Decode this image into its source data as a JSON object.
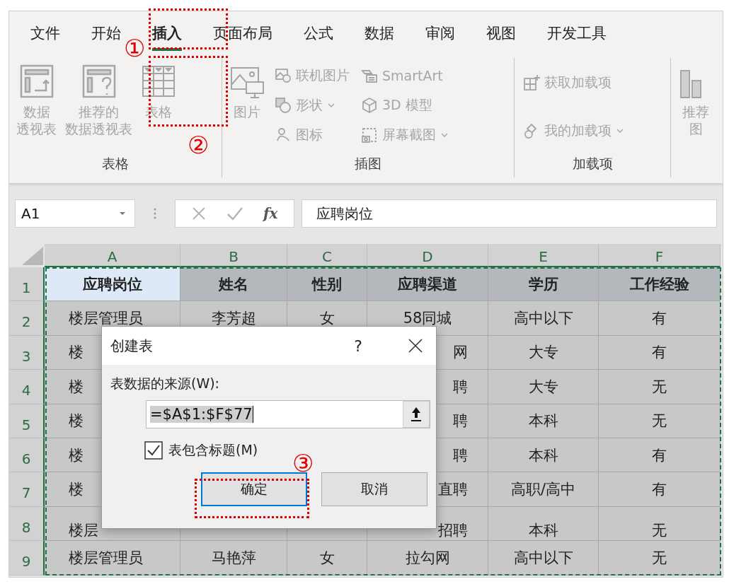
{
  "tabs": [
    {
      "label": "文件",
      "selected": false
    },
    {
      "label": "开始",
      "selected": false
    },
    {
      "label": "插入",
      "selected": true
    },
    {
      "label": "页面布局",
      "selected": false
    },
    {
      "label": "公式",
      "selected": false
    },
    {
      "label": "数据",
      "selected": false
    },
    {
      "label": "审阅",
      "selected": false
    },
    {
      "label": "视图",
      "selected": false
    },
    {
      "label": "开发工具",
      "selected": false
    }
  ],
  "ribbon": {
    "disabled": true,
    "groups": [
      {
        "label": "表格",
        "columns": [
          {
            "kind": "large",
            "lines": [
              "数据",
              "透视表"
            ]
          },
          {
            "kind": "large",
            "lines": [
              "推荐的",
              "数据透视表"
            ]
          },
          {
            "kind": "large",
            "lines": [
              "表格"
            ]
          }
        ]
      },
      {
        "label": "插图",
        "columns": [
          {
            "kind": "large",
            "lines": [
              "图片"
            ]
          },
          {
            "kind": "stack",
            "items": [
              {
                "label": "联机图片",
                "dropdown": false
              },
              {
                "label": "形状",
                "dropdown": true
              },
              {
                "label": "图标",
                "dropdown": false
              }
            ]
          },
          {
            "kind": "stack",
            "items": [
              {
                "label": "SmartArt",
                "dropdown": false
              },
              {
                "label": "3D 模型",
                "dropdown": false
              },
              {
                "label": "屏幕截图",
                "dropdown": true
              }
            ]
          }
        ]
      },
      {
        "label": "加载项",
        "columns": [
          {
            "kind": "stack",
            "items": [
              {
                "label": "获取加载项",
                "dropdown": false
              },
              {
                "label": "我的加载项",
                "dropdown": true
              }
            ]
          }
        ]
      },
      {
        "columns": [
          {
            "kind": "large",
            "lines": [
              "推荐",
              "图"
            ]
          }
        ]
      }
    ]
  },
  "formula_bar": {
    "name_box": "A1",
    "fx": "fx",
    "value": "应聘岗位"
  },
  "columns": [
    {
      "label": "A",
      "selected": true
    },
    {
      "label": "B",
      "selected": true
    },
    {
      "label": "C",
      "selected": true
    },
    {
      "label": "D",
      "selected": true
    },
    {
      "label": "E",
      "selected": true
    },
    {
      "label": "F",
      "selected": true
    }
  ],
  "rows": [
    {
      "number": "1",
      "cells": {
        "a": "应聘岗位",
        "b": "姓名",
        "c": "性别",
        "d": "应聘渠道",
        "e": "学历",
        "f": "工作经验"
      }
    },
    {
      "number": "2",
      "cells": {
        "a": "楼层管理员",
        "b": "李芳超",
        "c": "女",
        "d": "58同城",
        "e": "高中以下",
        "f": "有"
      }
    },
    {
      "number": "3",
      "cells": {
        "a": "楼",
        "d": "网",
        "e": "大专",
        "f": "有"
      }
    },
    {
      "number": "4",
      "cells": {
        "a": "楼",
        "d": "聘",
        "e": "大专",
        "f": "无"
      }
    },
    {
      "number": "5",
      "cells": {
        "a": "楼",
        "d": "聘",
        "e": "本科",
        "f": "无"
      }
    },
    {
      "number": "6",
      "cells": {
        "a": "楼",
        "d": "聘",
        "e": "本科",
        "f": "有"
      }
    },
    {
      "number": "7",
      "cells": {
        "a": "楼",
        "d": "直聘",
        "e": "高职/高中",
        "f": "有"
      }
    },
    {
      "number": "8",
      "cells": {
        "a": "楼层",
        "d": "招聘",
        "e": "本科",
        "f": "无"
      }
    },
    {
      "number": "9",
      "cells": {
        "a": "楼层管理员",
        "b": "马艳萍",
        "c": "女",
        "d": "拉勾网",
        "e": "高中以下",
        "f": "无"
      }
    }
  ],
  "dialog": {
    "title": "创建表",
    "help": "?",
    "source_label": "表数据的来源(W):",
    "source_value": "=$A$1:$F$77",
    "has_headers": {
      "label": "表包含标题(M)",
      "checked": true
    },
    "buttons": [
      {
        "label": "确定",
        "default": true
      },
      {
        "label": "取消",
        "default": false
      }
    ]
  },
  "markers": [
    "①",
    "②",
    "③"
  ]
}
